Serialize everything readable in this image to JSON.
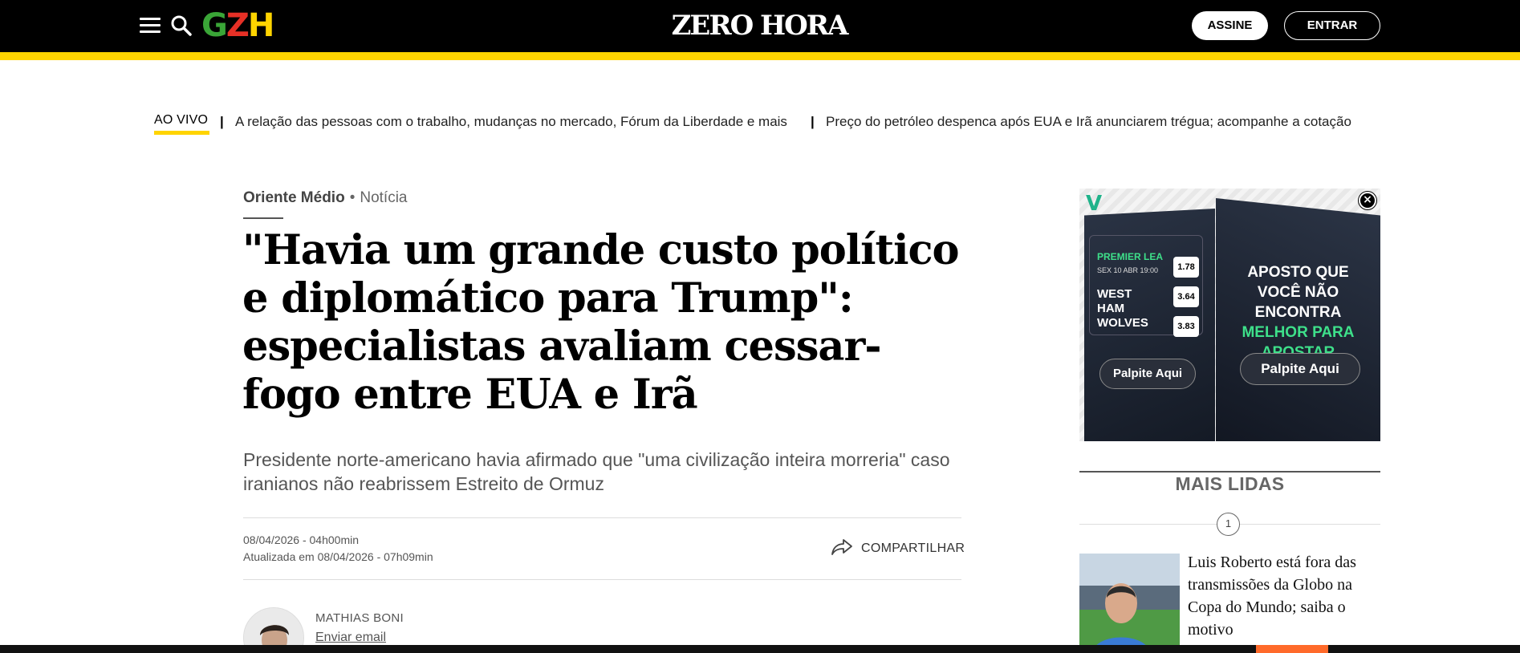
{
  "header": {
    "brand_left": "GZH",
    "brand_left_letters": [
      "G",
      "Z",
      "H"
    ],
    "brand_center": "ZERO HORA",
    "subscribe_label": "ASSINE",
    "login_label": "ENTRAR",
    "icons": [
      "menu-icon",
      "search-icon"
    ],
    "colors": {
      "bar": "#000000",
      "accent": "#ffd400",
      "gzh_g": "#3aa537",
      "gzh_z": "#e63026",
      "gzh_h": "#ffd400"
    }
  },
  "ticker": {
    "live_label": "AO VIVO",
    "separator": "|",
    "links": [
      "A relação das pessoas com o trabalho, mudanças no mercado, Fórum da Liberdade e mais",
      "Preço do petróleo despenca após EUA e Irã anunciarem trégua; acompanhe a cotação"
    ]
  },
  "article": {
    "section": "Oriente Médio",
    "bullet": "•",
    "type": "Notícia",
    "headline": "\"Havia um grande custo político e diplomático para Trump\": especialistas avaliam cessar-fogo entre EUA e Irã",
    "subtitle": "Presidente norte-americano havia afirmado que \"uma civilização inteira morreria\" caso iranianos não reabrissem Estreito de Ormuz",
    "published": "08/04/2026 - 04h00min",
    "updated": "Atualizada em 08/04/2026 - 07h09min",
    "share_label": "COMPARTILHAR",
    "author_name": "MATHIAS BONI",
    "author_email_label": "Enviar email"
  },
  "ad": {
    "logo": "V",
    "close_glyph": "×",
    "league": "PREMIER LEA",
    "date": "SEX 10 ABR 19:00",
    "teams": "WEST HAM WOLVES",
    "odds": [
      "1.78",
      "3.64",
      "3.83"
    ],
    "button_left": "Palpite Aqui",
    "slogan_part1": "APOSTO QUE VOCÊ NÃO ENCONTRA ",
    "slogan_highlight": "MELHOR PARA APOSTAR",
    "button_right": "Palpite Aqui"
  },
  "most_read": {
    "title": "MAIS LIDAS",
    "items": [
      {
        "rank": "1",
        "text": "Luis Roberto está fora das transmissões da Globo na Copa do Mundo; saiba o motivo"
      }
    ]
  }
}
